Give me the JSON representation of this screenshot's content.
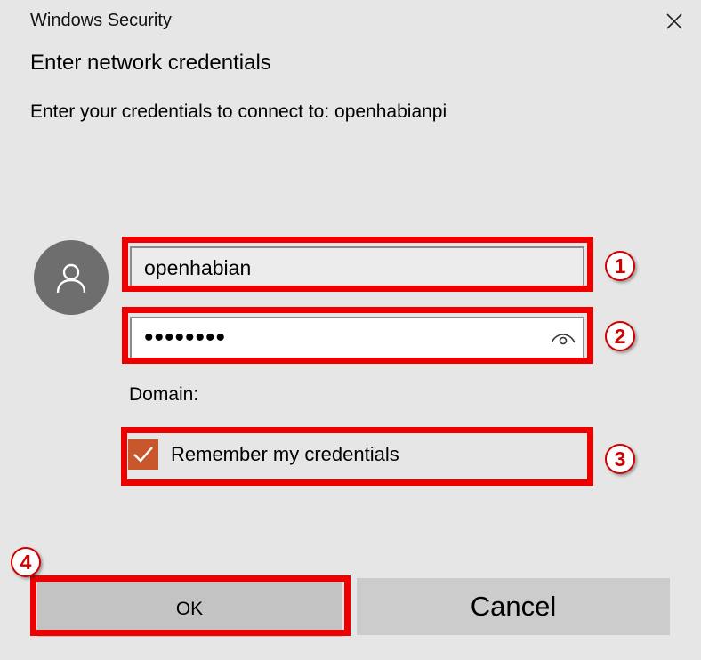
{
  "window": {
    "title": "Windows Security",
    "close_icon": "close-icon"
  },
  "dialog": {
    "heading": "Enter network credentials",
    "subtext": "Enter your credentials to connect to: openhabianpi"
  },
  "form": {
    "avatar_icon": "user-icon",
    "username_value": "openhabian",
    "password_value": "••••••••",
    "reveal_icon": "eye-icon",
    "domain_label": "Domain:",
    "remember_label": "Remember my credentials",
    "remember_checked": true
  },
  "buttons": {
    "ok_label": "OK",
    "cancel_label": "Cancel"
  },
  "annotations": [
    "1",
    "2",
    "3",
    "4"
  ],
  "colors": {
    "background": "#e6e6e6",
    "checkbox_accent": "#c8582c",
    "highlight": "#ee0000"
  }
}
